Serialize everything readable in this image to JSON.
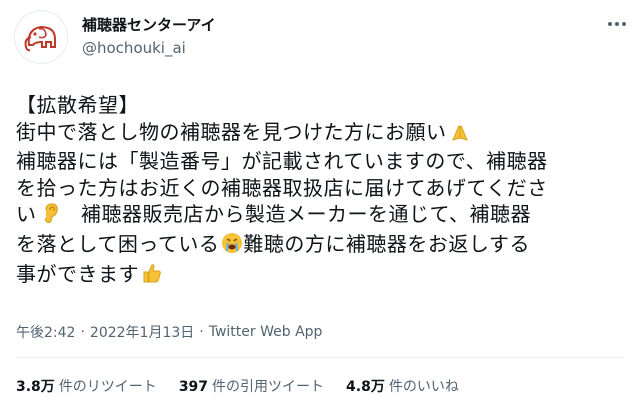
{
  "account": {
    "display_name": "補聴器センターアイ",
    "handle": "@hochouki_ai",
    "avatar_icon": "elephant-logo-icon"
  },
  "tweet": {
    "lines": [
      "【拡散希望】",
      "街中で落とし物の補聴器を見つけた方にお願い",
      "補聴器には「製造番号」が記載されていますので、補聴器",
      "を拾った方はお近くの補聴器取扱店に届けてあげてくださ",
      "い",
      "　補聴器販売店から製造メーカーを通じて、補聴器",
      "を落として困っている",
      "難聴の方に補聴器をお返しする",
      "事ができます"
    ],
    "emoji": {
      "folded_hands": "folded-hands-icon",
      "ear": "ear-icon",
      "crying_face": "crying-face-icon",
      "thumbs_up": "thumbs-up-icon"
    }
  },
  "meta": {
    "time": "午後2:42",
    "separator": "·",
    "date": "2022年1月13日",
    "source": "Twitter Web App"
  },
  "stats": {
    "retweets_count": "3.8万",
    "retweets_label": "件のリツイート",
    "quotes_count": "397",
    "quotes_label": "件の引用ツイート",
    "likes_count": "4.8万",
    "likes_label": "件のいいね"
  },
  "colors": {
    "text": "#0f1419",
    "secondary": "#536471",
    "divider": "#eff3f4",
    "emoji_yellow": "#f7c137"
  }
}
